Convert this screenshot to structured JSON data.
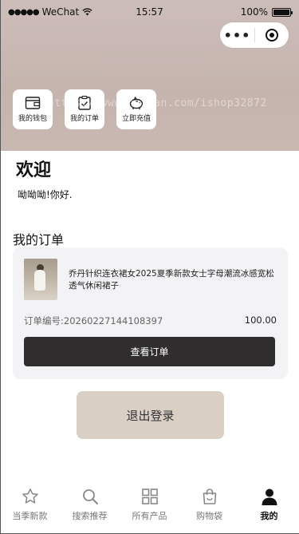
{
  "status_bar": {
    "carrier": "WeChat",
    "time": "15:57",
    "battery": "100%",
    "battery_level": 1.0
  },
  "capsule": {
    "more": "•••"
  },
  "quick_actions": [
    {
      "label": "我的钱包",
      "icon": "wallet-icon"
    },
    {
      "label": "我的订单",
      "icon": "order-icon"
    },
    {
      "label": "立即充值",
      "icon": "piggy-bank-icon"
    }
  ],
  "watermark": "https://www.huzhan.com/ishop32872",
  "welcome": {
    "title": "欢迎",
    "subtitle": "呦呦呦!你好."
  },
  "orders": {
    "title": "我的订单",
    "item": {
      "name": "乔丹针织连衣裙女2025夏季新款女士字母潮流冰感宽松透气休闲裙子",
      "order_number": "订单编号:20260227144108397",
      "price": "100.00"
    },
    "view_button": "查看订单"
  },
  "logout_button": "退出登录",
  "tab_bar": [
    {
      "label": "当季新款",
      "icon": "star-icon",
      "active": false
    },
    {
      "label": "搜索推荐",
      "icon": "search-icon",
      "active": false
    },
    {
      "label": "所有产品",
      "icon": "grid-icon",
      "active": false
    },
    {
      "label": "购物袋",
      "icon": "shopping-bag-icon",
      "active": false
    },
    {
      "label": "我的",
      "icon": "user-icon",
      "active": true
    }
  ],
  "colors": {
    "banner": "#c8b7b1",
    "card_bg": "#f3f3f5",
    "primary_button": "#2f2d2d",
    "logout_button": "#d9cfc5"
  }
}
